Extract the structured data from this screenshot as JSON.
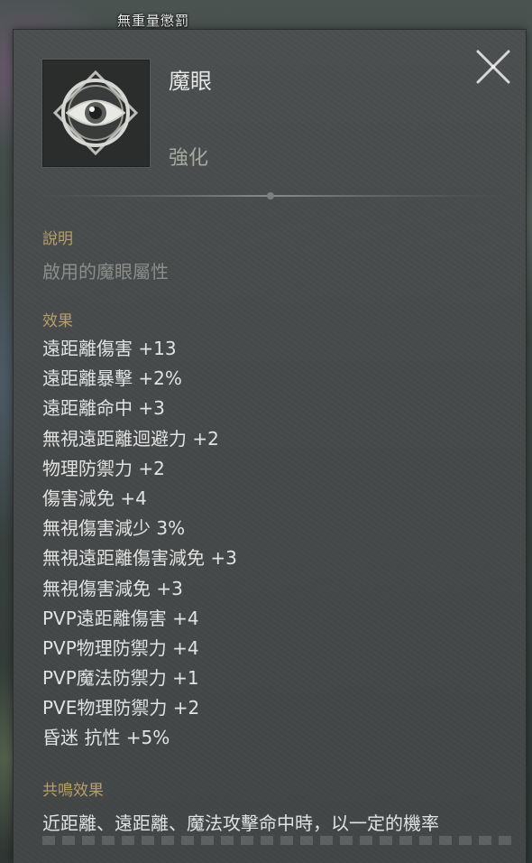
{
  "top_label": "無重量懲罰",
  "item": {
    "icon": "eye-icon",
    "name": "魔眼",
    "grade": "強化"
  },
  "close": {
    "icon": "close-icon"
  },
  "description": {
    "label": "說明",
    "text": "啟用的魔眼屬性"
  },
  "effects": {
    "label": "效果",
    "items": [
      "遠距離傷害 +13",
      "遠距離暴擊 +2%",
      "遠距離命中 +3",
      "無視遠距離迴避力 +2",
      "物理防禦力 +2",
      "傷害減免 +4",
      "無視傷害減少 3%",
      "無視遠距離傷害減免 +3",
      "無視傷害減免 +3",
      "PVP遠距離傷害 +4",
      "PVP物理防禦力 +4",
      "PVP魔法防禦力 +1",
      "PVE物理防禦力 +2",
      "昏迷 抗性 +5%"
    ]
  },
  "resonance": {
    "label": "共鳴效果",
    "text": "近距離、遠距離、魔法攻擊命中時，以一定的機率"
  },
  "colors": {
    "panel": "#474a4a",
    "section_label": "#b79e6c",
    "text": "#e2e2e2",
    "muted": "#8d8d8a"
  }
}
